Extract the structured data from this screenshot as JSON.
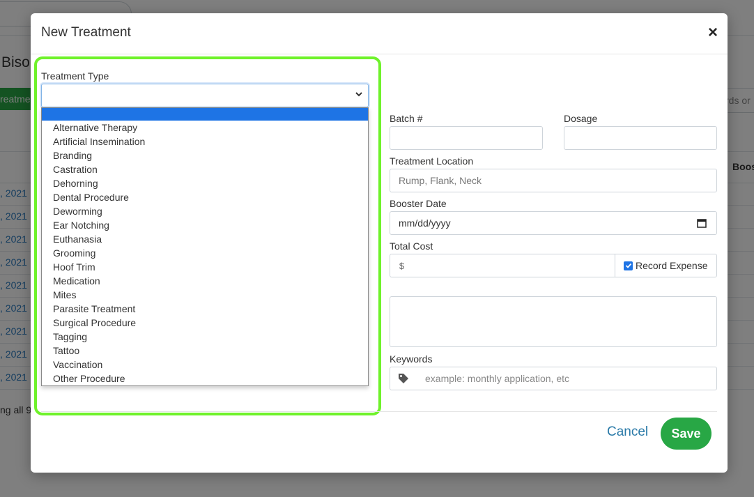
{
  "background": {
    "title": "Bisor",
    "treatment_button": "reatme",
    "search_placeholder": "rds or",
    "column_header": "Boos",
    "dates": [
      ", 2021",
      ", 2021",
      ", 2021",
      ", 2021",
      ", 2021",
      ", 2021",
      ", 2021",
      ", 2021",
      ", 2021"
    ],
    "footer": "ng all 9"
  },
  "modal": {
    "title": "New Treatment",
    "close": "×",
    "treatment_type": {
      "label": "Treatment Type",
      "value": "",
      "options": [
        "",
        "Alternative Therapy",
        "Artificial Insemination",
        "Branding",
        "Castration",
        "Dehorning",
        "Dental Procedure",
        "Deworming",
        "Ear Notching",
        "Euthanasia",
        "Grooming",
        "Hoof Trim",
        "Medication",
        "Mites",
        "Parasite Treatment",
        "Surgical Procedure",
        "Tagging",
        "Tattoo",
        "Vaccination",
        "Other Procedure"
      ]
    },
    "batch": {
      "label": "Batch #",
      "value": ""
    },
    "dosage": {
      "label": "Dosage",
      "value": ""
    },
    "location": {
      "label": "Treatment Location",
      "placeholder": "Rump, Flank, Neck"
    },
    "booster": {
      "label": "Booster Date",
      "placeholder": "mm/dd/yyyy"
    },
    "total_cost": {
      "label": "Total Cost",
      "prefix": "$",
      "value": "",
      "record_expense_label": "Record Expense",
      "record_expense_checked": true
    },
    "notes": {
      "value": ""
    },
    "keywords": {
      "label": "Keywords",
      "placeholder": "example: monthly application, etc"
    },
    "cancel_label": "Cancel",
    "save_label": "Save"
  },
  "colors": {
    "highlight": "#6ff22b",
    "save": "#28a745",
    "selected_option": "#1e74e5",
    "link": "#2a7aa8"
  }
}
